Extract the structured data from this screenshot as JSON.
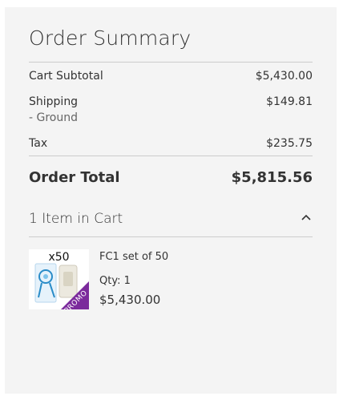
{
  "summary": {
    "title": "Order Summary",
    "rows": [
      {
        "label": "Cart Subtotal",
        "value": "$5,430.00"
      },
      {
        "label": "Shipping",
        "sublabel": "- Ground",
        "value": "$149.81"
      },
      {
        "label": "Tax",
        "value": "$235.75"
      }
    ],
    "total": {
      "label": "Order Total",
      "value": "$5,815.56"
    }
  },
  "cart": {
    "toggle_label": "1 Item in Cart",
    "toggle_icon": "chevron-up-icon",
    "items": [
      {
        "image_qty_text": "x50",
        "image_badge_text": "PROMO",
        "name": "FC1 set of 50",
        "qty_label": "Qty:",
        "qty_value": "1",
        "price": "$5,430.00"
      }
    ]
  },
  "colors": {
    "panel_background": "#f4f4f4",
    "divider": "#cccccc",
    "promo_badge": "#7b2a9c",
    "thumb_accent": "#2a8cc8"
  }
}
